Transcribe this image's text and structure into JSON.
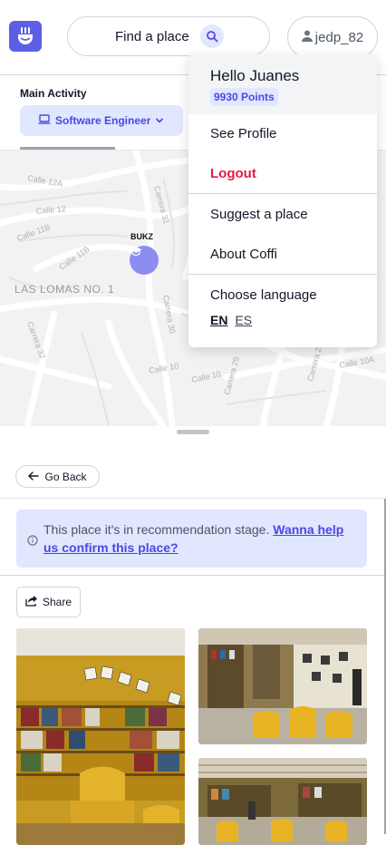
{
  "header": {
    "search_label": "Find a place",
    "username": "jedp_82"
  },
  "activity": {
    "label": "Main Activity",
    "selected": "Software Engineer"
  },
  "map": {
    "labels": [
      "Calle 12A",
      "Calle 12",
      "Calle 11B",
      "Calle 11B",
      "Carrera 31",
      "LAS LOMAS NO. 1",
      "Carrera 32",
      "Carrera 30",
      "Calle 10",
      "Calle 10",
      "Carrera 29",
      "Carrera 28",
      "Calle 10A"
    ],
    "pin_label": "BUKZ"
  },
  "nav": {
    "go_back": "Go Back"
  },
  "notice": {
    "text": "This place it's in recommendation stage.",
    "link": "Wanna help us confirm this place?"
  },
  "actions": {
    "share": "Share"
  },
  "dropdown": {
    "greeting": "Hello Juanes",
    "points": "9930 Points",
    "see_profile": "See Profile",
    "logout": "Logout",
    "suggest": "Suggest a place",
    "about": "About Coffi",
    "choose_language": "Choose language",
    "lang_en": "EN",
    "lang_es": "ES"
  },
  "colors": {
    "accent": "#4f46e5",
    "logo_bg": "#5b5fe6",
    "logout": "#e11d48",
    "chip_bg": "#e0e7ff"
  },
  "icons": [
    "app-logo-icon",
    "search-icon",
    "user-icon",
    "laptop-icon",
    "chevron-down-icon",
    "graduation-cap-icon",
    "arrow-left-icon",
    "info-icon",
    "share-icon"
  ]
}
